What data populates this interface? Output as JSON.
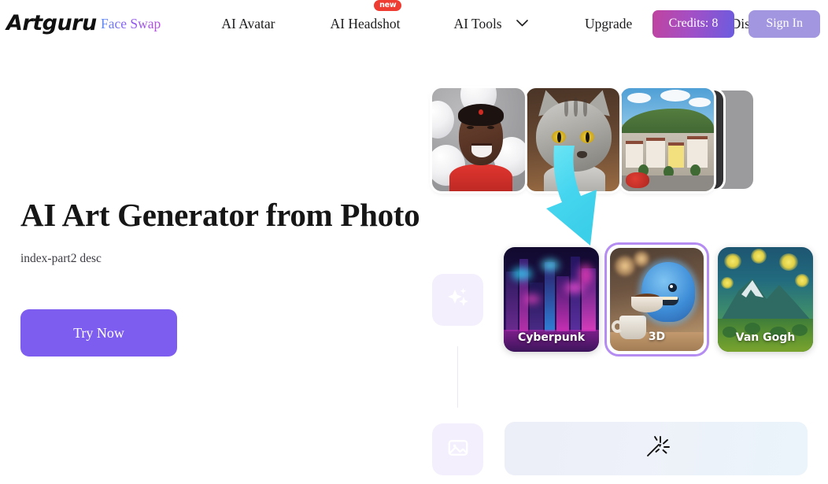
{
  "brand": {
    "name": "Artguru"
  },
  "nav": {
    "items": [
      {
        "label": "Face Swap",
        "icon": "sparkle-icon",
        "gradient": true
      },
      {
        "label": "AI Avatar"
      },
      {
        "label": "AI Headshot",
        "badge": "new"
      },
      {
        "label": "AI Tools",
        "icon": "chevron-down-icon"
      },
      {
        "label": "Upgrade"
      },
      {
        "label": "Join the Discord"
      }
    ],
    "credits_label": "Credits: 8",
    "signin_label": "Sign In"
  },
  "hero": {
    "title": "AI Art Generator from Photo",
    "description": "index-part2 desc",
    "cta_label": "Try Now"
  },
  "showcase": {
    "photos": [
      {
        "name": "man-with-balloons"
      },
      {
        "name": "gray-tabby-cat"
      },
      {
        "name": "european-village"
      }
    ],
    "stack_cards": [
      {
        "color": "#333335"
      },
      {
        "color": "#9b9b9e"
      }
    ],
    "arrow": {
      "name": "down-arrow-icon",
      "color": "#4fd9ef"
    },
    "styles": [
      {
        "label": "Cyberpunk",
        "selected": false
      },
      {
        "label": "3D",
        "selected": true
      },
      {
        "label": "Van Gogh",
        "selected": false
      }
    ],
    "selected_border_color": "#b48cf2",
    "panels": [
      {
        "icon": "sparkles-icon"
      },
      {
        "icon": "image-icon"
      }
    ],
    "generate_bar": {
      "icon": "magic-wand-icon"
    }
  },
  "colors": {
    "primary_purple": "#7d5cf0",
    "badge_red": "#ef3c32",
    "signin_purple": "#a396e0",
    "arrow_cyan": "#4fd9ef"
  }
}
